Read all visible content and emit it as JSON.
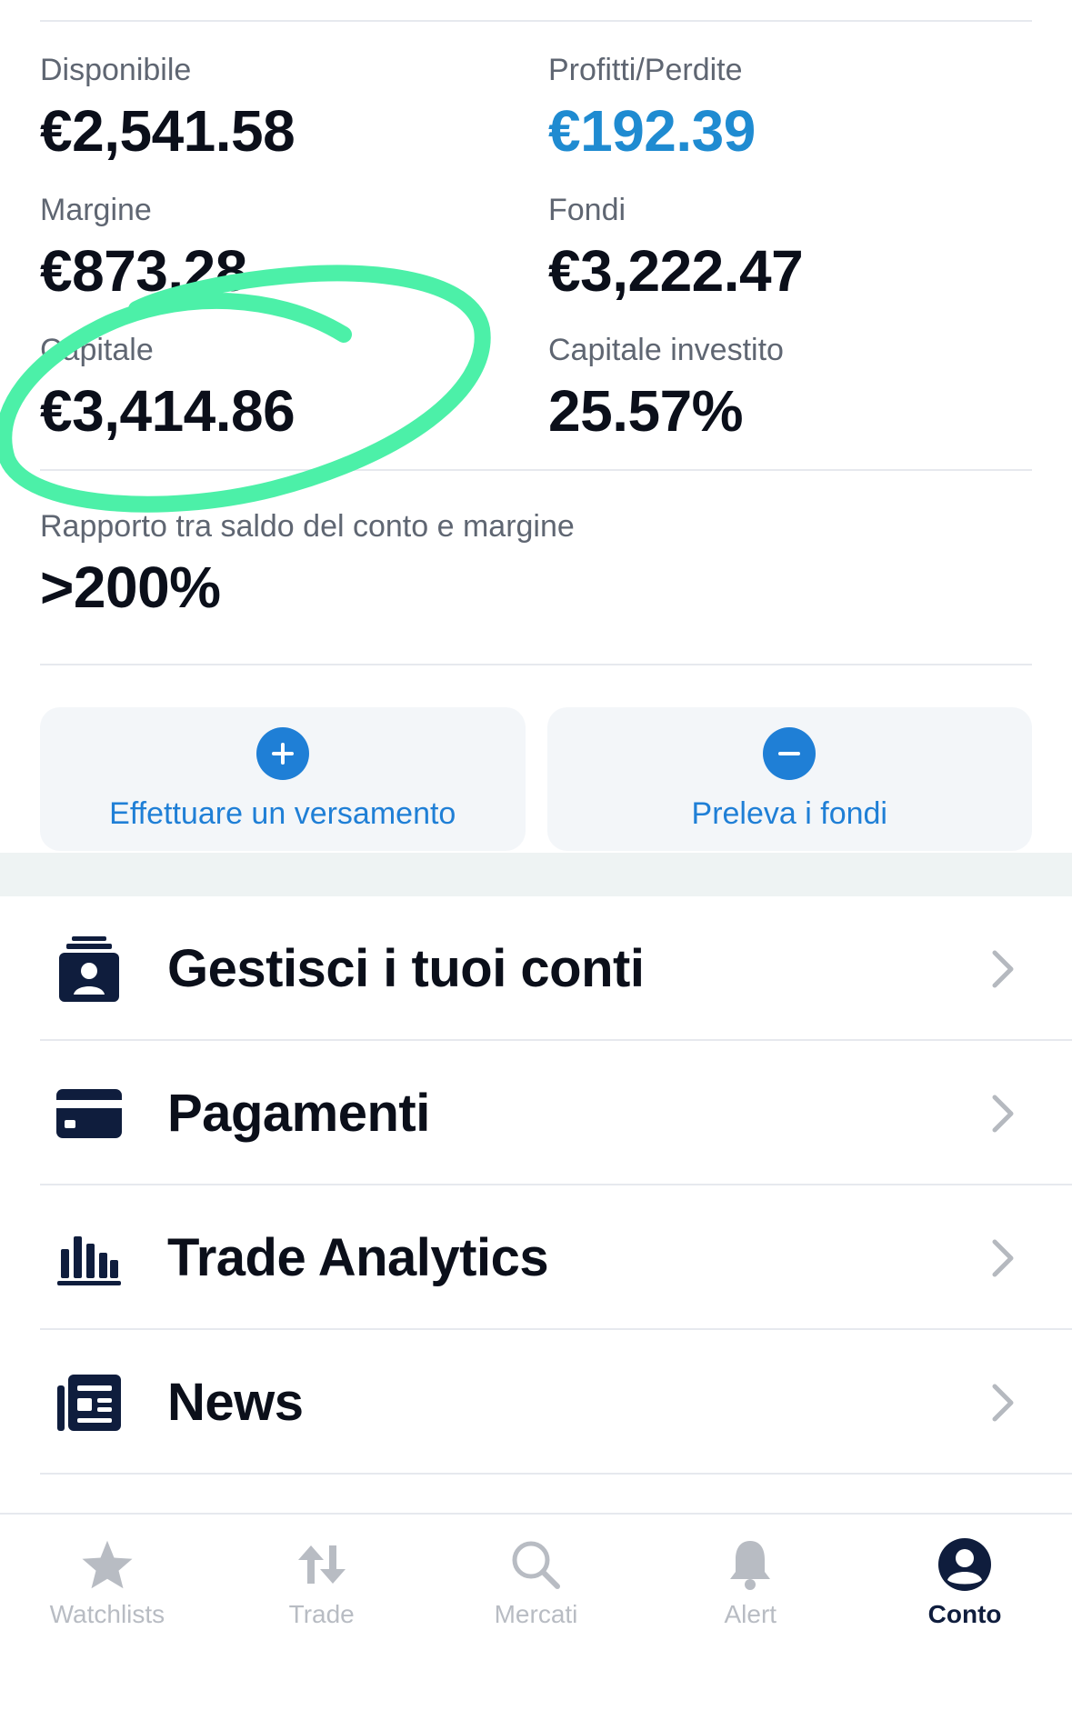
{
  "stats": {
    "disponibile": {
      "label": "Disponibile",
      "value": "€2,541.58"
    },
    "profitti": {
      "label": "Profitti/Perdite",
      "value": "€192.39",
      "color": "#1f8bd1"
    },
    "margine": {
      "label": "Margine",
      "value": "€873.28"
    },
    "fondi": {
      "label": "Fondi",
      "value": "€3,222.47"
    },
    "capitale": {
      "label": "Capitale",
      "value": "€3,414.86"
    },
    "capitale_investito": {
      "label": "Capitale investito",
      "value": "25.57%"
    },
    "rapporto": {
      "label": "Rapporto tra saldo del conto e margine",
      "value": ">200%"
    }
  },
  "actions": {
    "deposit": {
      "label": "Effettuare un versamento",
      "icon": "plus-circle-icon"
    },
    "withdraw": {
      "label": "Preleva i fondi",
      "icon": "minus-circle-icon"
    }
  },
  "menu": [
    {
      "label": "Gestisci i tuoi conti",
      "icon": "account-badge-icon"
    },
    {
      "label": "Pagamenti",
      "icon": "credit-card-icon"
    },
    {
      "label": "Trade Analytics",
      "icon": "bar-chart-icon"
    },
    {
      "label": "News",
      "icon": "newspaper-icon"
    }
  ],
  "tabs": [
    {
      "label": "Watchlists",
      "icon": "star-icon",
      "active": false
    },
    {
      "label": "Trade",
      "icon": "swap-arrows-icon",
      "active": false
    },
    {
      "label": "Mercati",
      "icon": "search-icon",
      "active": false
    },
    {
      "label": "Alert",
      "icon": "bell-icon",
      "active": false
    },
    {
      "label": "Conto",
      "icon": "user-circle-icon",
      "active": true
    }
  ],
  "colors": {
    "accent": "#1f7fd6",
    "active_tab": "#0f1d3d",
    "inactive_tab": "#b8bcc3",
    "annotation": "#4cf0a8"
  }
}
